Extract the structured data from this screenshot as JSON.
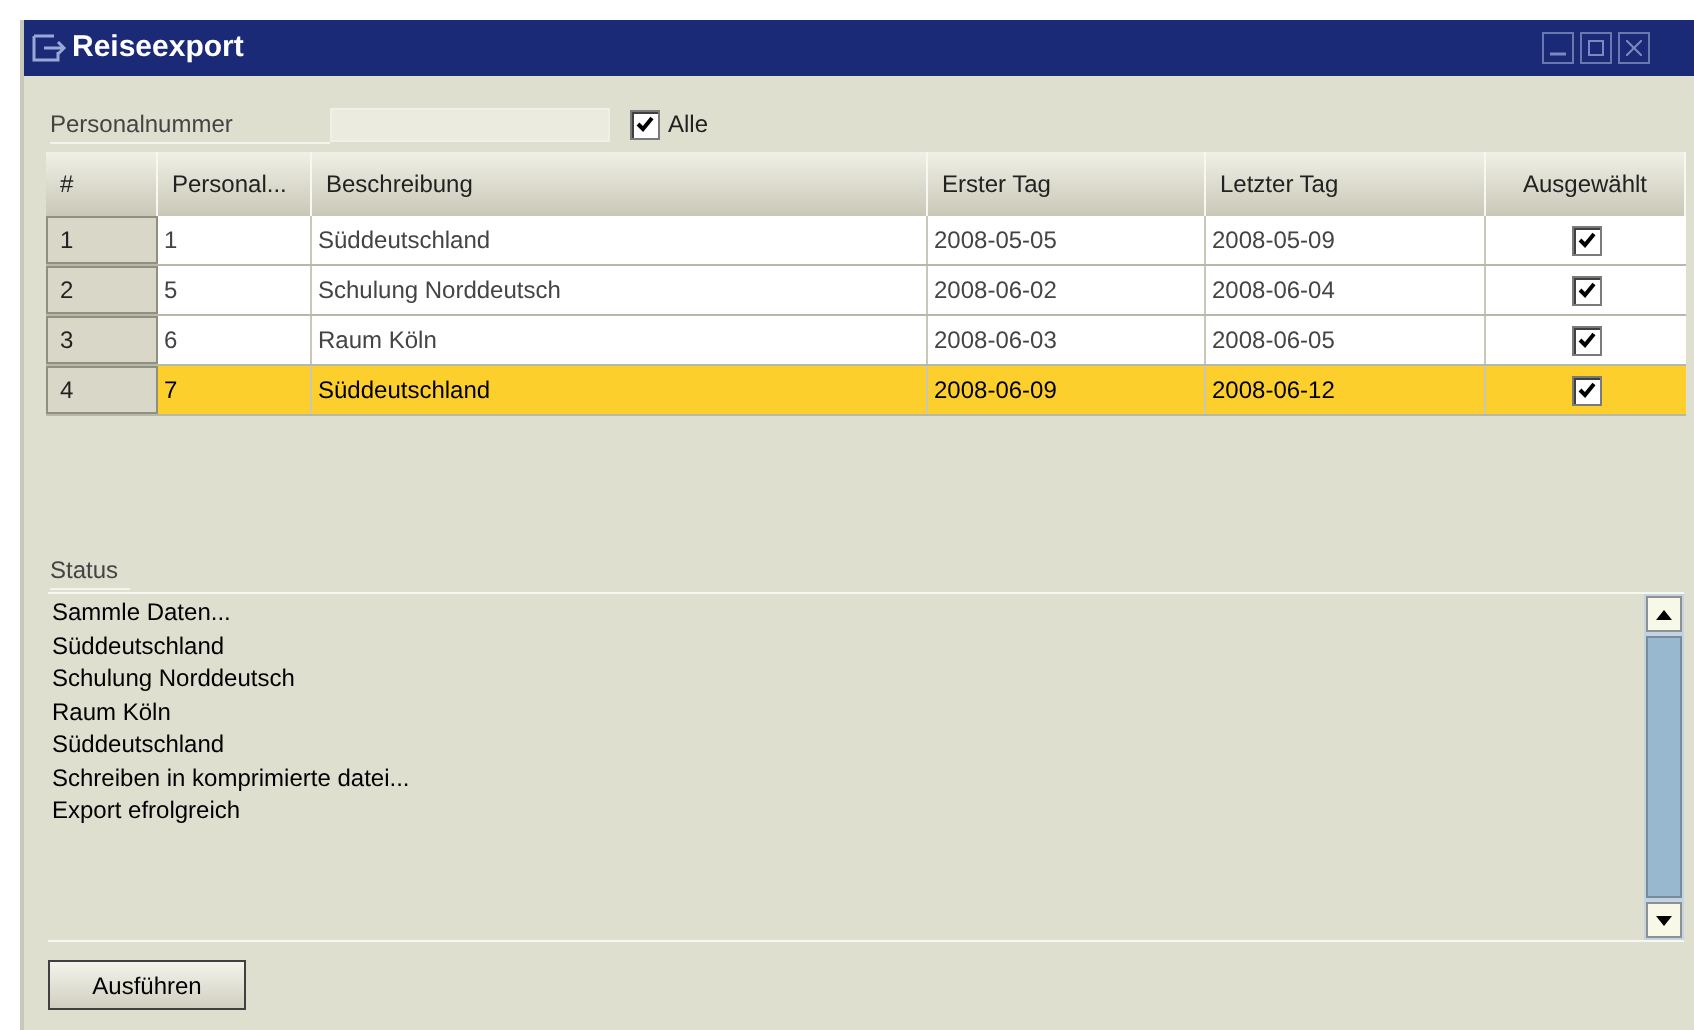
{
  "window": {
    "title": "Reiseexport"
  },
  "filter": {
    "label": "Personalnummer",
    "value_field": {
      "disabled": true
    },
    "all_checkbox": {
      "label": "Alle",
      "checked": true
    }
  },
  "table": {
    "columns": [
      "#",
      "Personal...",
      "Beschreibung",
      "Erster Tag",
      "Letzter Tag",
      "Ausgewählt"
    ],
    "rows": [
      {
        "index": "1",
        "personal": "1",
        "description": "Süddeutschland",
        "first_day": "2008-05-05",
        "last_day": "2008-05-09",
        "checked": true,
        "selected": false
      },
      {
        "index": "2",
        "personal": "5",
        "description": "Schulung Norddeutsch",
        "first_day": "2008-06-02",
        "last_day": "2008-06-04",
        "checked": true,
        "selected": false
      },
      {
        "index": "3",
        "personal": "6",
        "description": "Raum Köln",
        "first_day": "2008-06-03",
        "last_day": "2008-06-05",
        "checked": true,
        "selected": false
      },
      {
        "index": "4",
        "personal": "7",
        "description": "Süddeutschland",
        "first_day": "2008-06-09",
        "last_day": "2008-06-12",
        "checked": true,
        "selected": true
      }
    ]
  },
  "status": {
    "label": "Status",
    "lines": [
      "Sammle Daten...",
      "Süddeutschland",
      "Schulung Norddeutsch",
      "Raum Köln",
      "Süddeutschland",
      "Schreiben in komprimierte datei...",
      "Export efrolgreich"
    ]
  },
  "buttons": [
    "Ausführen"
  ]
}
